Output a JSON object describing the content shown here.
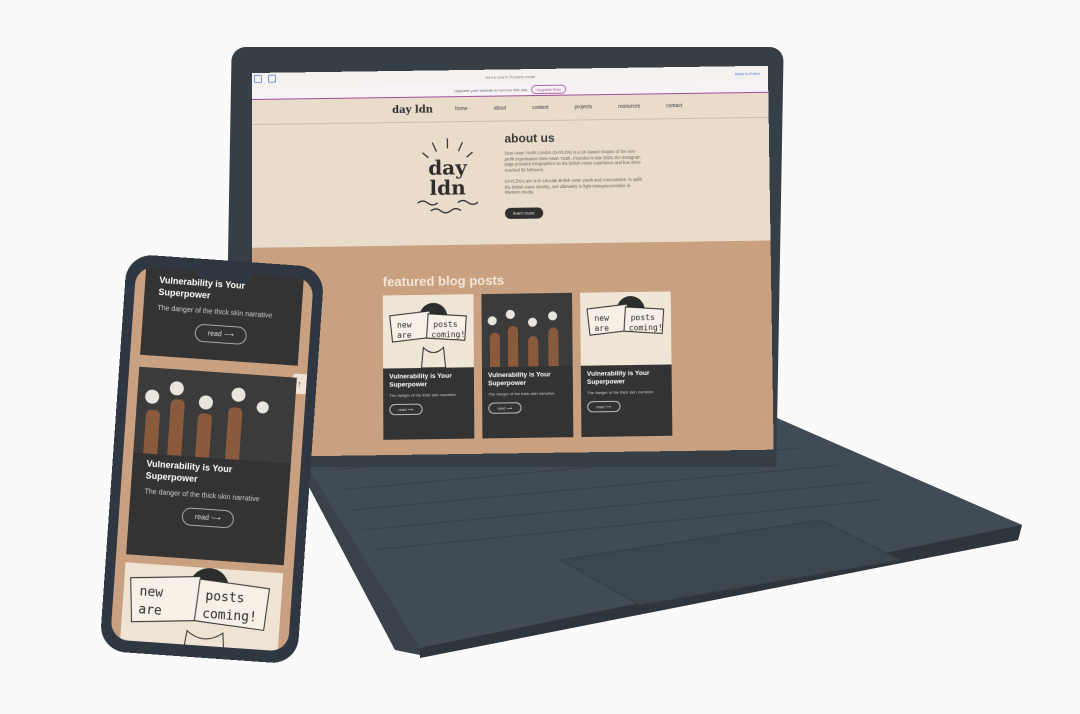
{
  "laptop": {
    "wix": {
      "preview_text": "You're now in Preview mode",
      "back_label": "Back to Editor",
      "upgrade_text": "Upgrade your website to remove Wix ads",
      "upgrade_button": "Upgrade Now"
    },
    "site": {
      "logo": "day ldn",
      "nav": [
        "home",
        "about",
        "content",
        "projects",
        "resources",
        "contact"
      ],
      "about": {
        "title": "about us",
        "para1": "Desi Asian Youth London (DAYLDN) is a UK-based chapter of the non-profit organisation Desi Asian Youth. Founded in late 2020, the Instagram page provides infographics on the British Asian experience and has since reached 5k followers.",
        "para2": "DAYLDN's aim is to educate British Asian youth and communities, to uplift the British Asian identity, and ultimately to fight misrepresentation in Western media.",
        "button": "learn more"
      },
      "featured": {
        "title": "featured blog posts",
        "cards": [
          {
            "title": "Vulnerability is Your Superpower",
            "subtitle": "The danger of the thick skin narrative",
            "read": "read"
          },
          {
            "title": "Vulnerability is Your Superpower",
            "subtitle": "The danger of the thick skin narrative",
            "read": "read"
          },
          {
            "title": "Vulnerability is Your Superpower",
            "subtitle": "The danger of the thick skin narrative",
            "read": "read"
          }
        ],
        "poster_words": [
          "new",
          "posts",
          "are",
          "coming!"
        ]
      }
    }
  },
  "phone": {
    "card1": {
      "title": "Vulnerability is Your Superpower",
      "subtitle": "The danger of the thick skin narrative",
      "read": "read"
    },
    "card2": {
      "title": "Vulnerability is Your Superpower",
      "subtitle": "The danger of the thick skin narrative",
      "read": "read"
    },
    "poster_words": [
      "new",
      "posts",
      "are",
      "coming!"
    ],
    "scroll_icon": "arrow-up-icon"
  },
  "colors": {
    "page_bg": "#e9dccb",
    "featured_bg": "#c9a080",
    "card_bg": "#333333",
    "device_body": "#363e46"
  }
}
